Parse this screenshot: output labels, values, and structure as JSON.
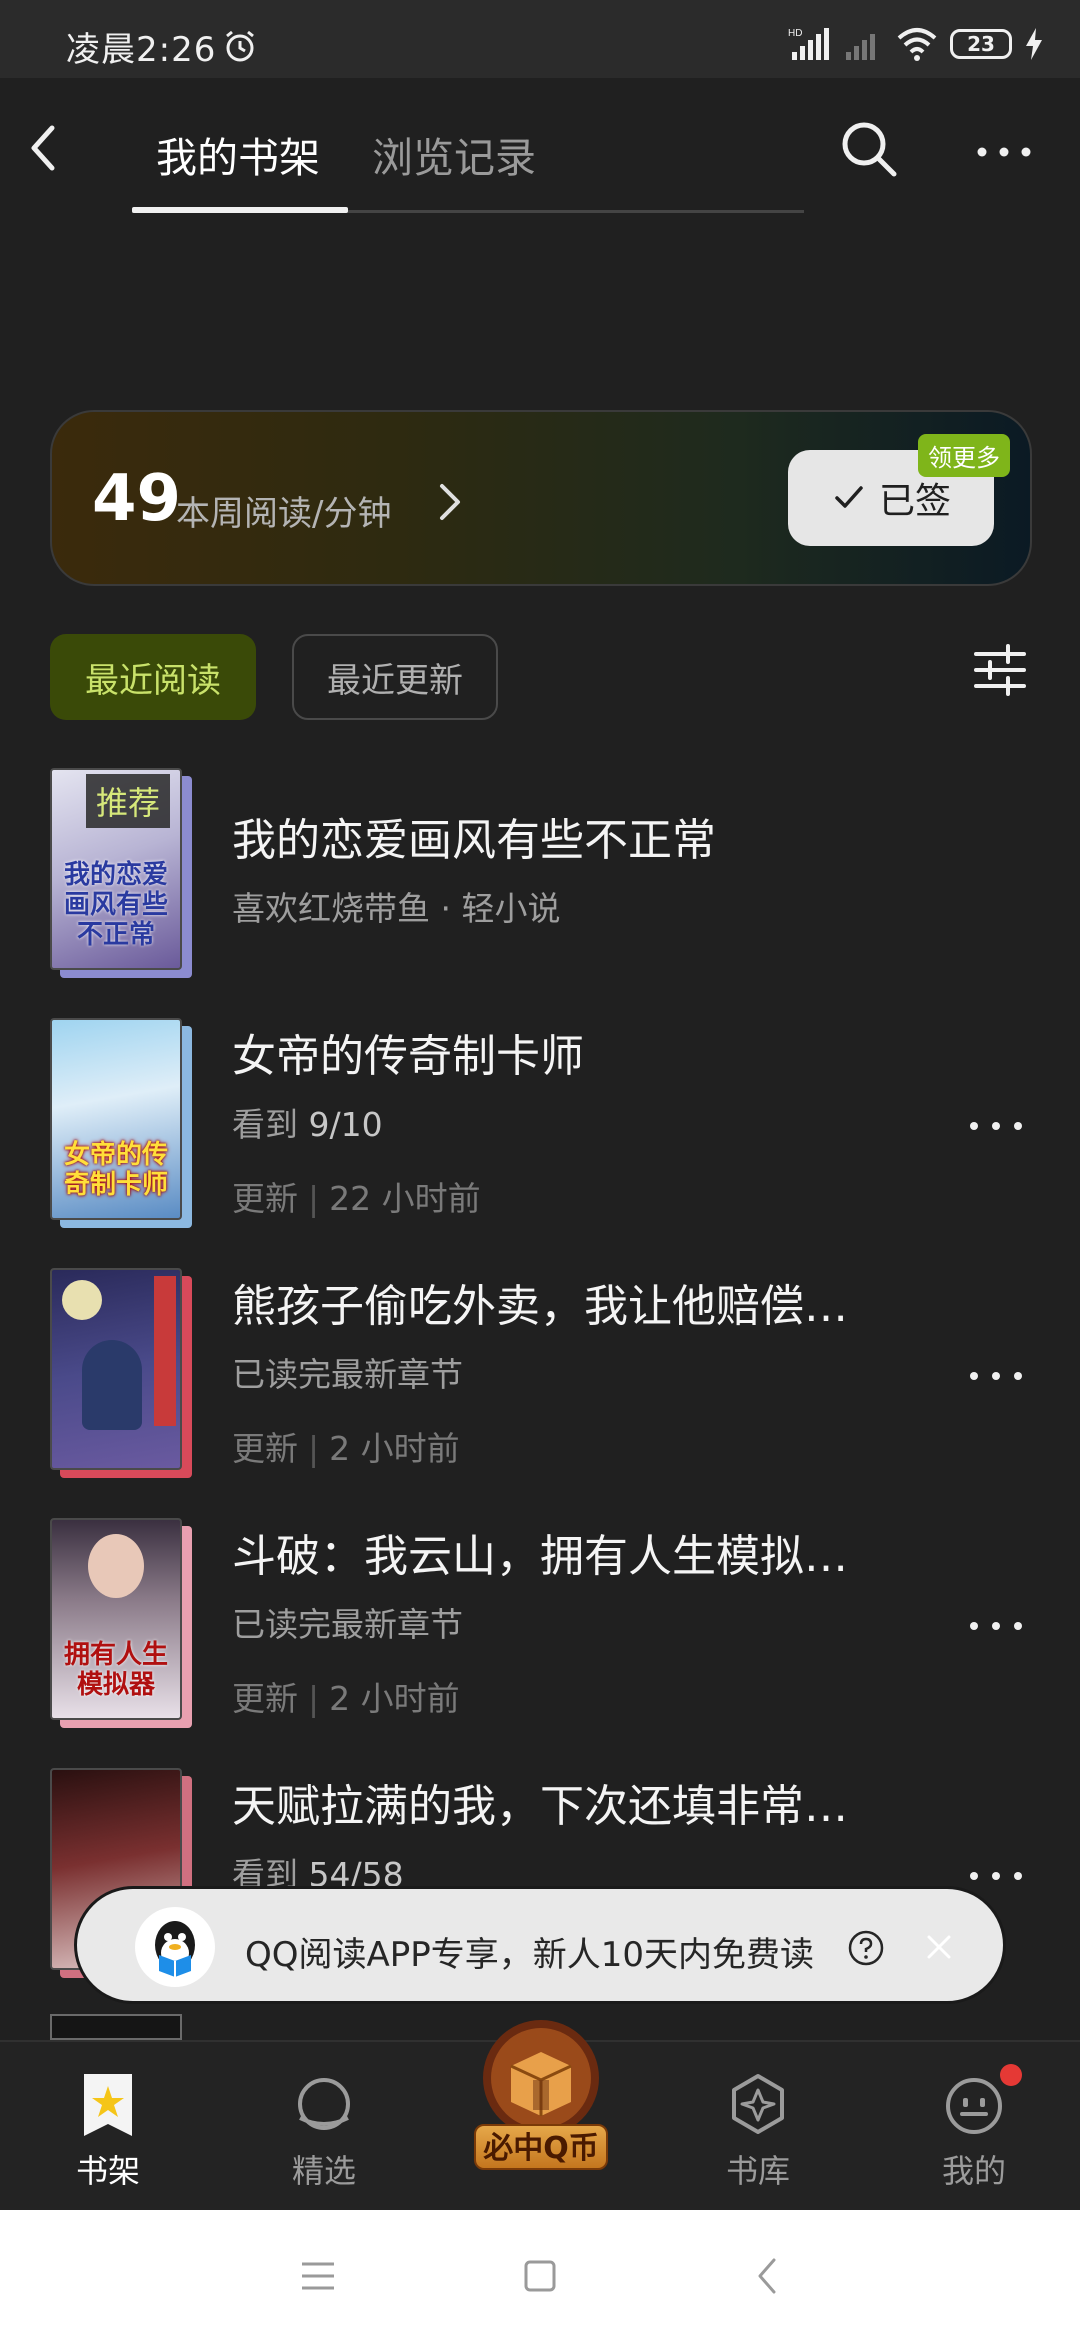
{
  "status_bar": {
    "time": "凌晨2:26",
    "battery": "23"
  },
  "header": {
    "tabs": [
      {
        "label": "我的书架",
        "active": true
      },
      {
        "label": "浏览记录",
        "active": false
      }
    ]
  },
  "stats": {
    "minutes": "49",
    "label": "本周阅读/分钟",
    "sign_button": "已签",
    "badge": "领更多"
  },
  "filters": {
    "recent": "最近阅读",
    "updated": "最近更新"
  },
  "books": [
    {
      "title": "我的恋爱画风有些不正常",
      "meta": "喜欢红烧带鱼 · 轻小说",
      "badge": "推荐",
      "cover_text": "我的恋爱画风有些不正常",
      "cover_colors": [
        "#c8c8dc",
        "#7c6aa0"
      ]
    },
    {
      "title": "女帝的传奇制卡师",
      "meta_prefix": "看到 ",
      "meta_value": "9/10",
      "update_prefix": "更新",
      "update_value": "22 小时前",
      "cover_text": "女帝的传奇制卡师",
      "cover_colors": [
        "#7fc0e8",
        "#2a5f9e"
      ]
    },
    {
      "title": "熊孩子偷吃外卖，我让他赔偿…",
      "meta": "已读完最新章节",
      "update_prefix": "更新",
      "update_value": "2 小时前",
      "cover_text": "",
      "cover_colors": [
        "#3a3a6e",
        "#d84a5a"
      ]
    },
    {
      "title": "斗破：我云山，拥有人生模拟…",
      "meta": "已读完最新章节",
      "update_prefix": "更新",
      "update_value": "2 小时前",
      "cover_text": "拥有人生模拟器",
      "cover_colors": [
        "#5a4a5a",
        "#e8d8e0"
      ]
    },
    {
      "title": "天赋拉满的我，下次还填非常…",
      "meta_prefix": "看到 ",
      "meta_value": "54/58",
      "cover_text": "",
      "cover_colors": [
        "#3a1a1a",
        "#c4a0a0"
      ]
    }
  ],
  "toast": {
    "text": "QQ阅读APP专享，新人10天内免费读"
  },
  "bottom_nav": [
    {
      "label": "书架",
      "icon": "star-bookmark-icon",
      "active": true
    },
    {
      "label": "精选",
      "icon": "planet-icon",
      "active": false
    },
    {
      "label": "必中Q币",
      "icon": "gift-box-icon",
      "active": false
    },
    {
      "label": "书库",
      "icon": "compass-icon",
      "active": false
    },
    {
      "label": "我的",
      "icon": "smiley-icon",
      "active": false
    }
  ],
  "colors": {
    "background": "#202020",
    "accent_green": "#7fb51a",
    "notification_red": "#e53935"
  }
}
